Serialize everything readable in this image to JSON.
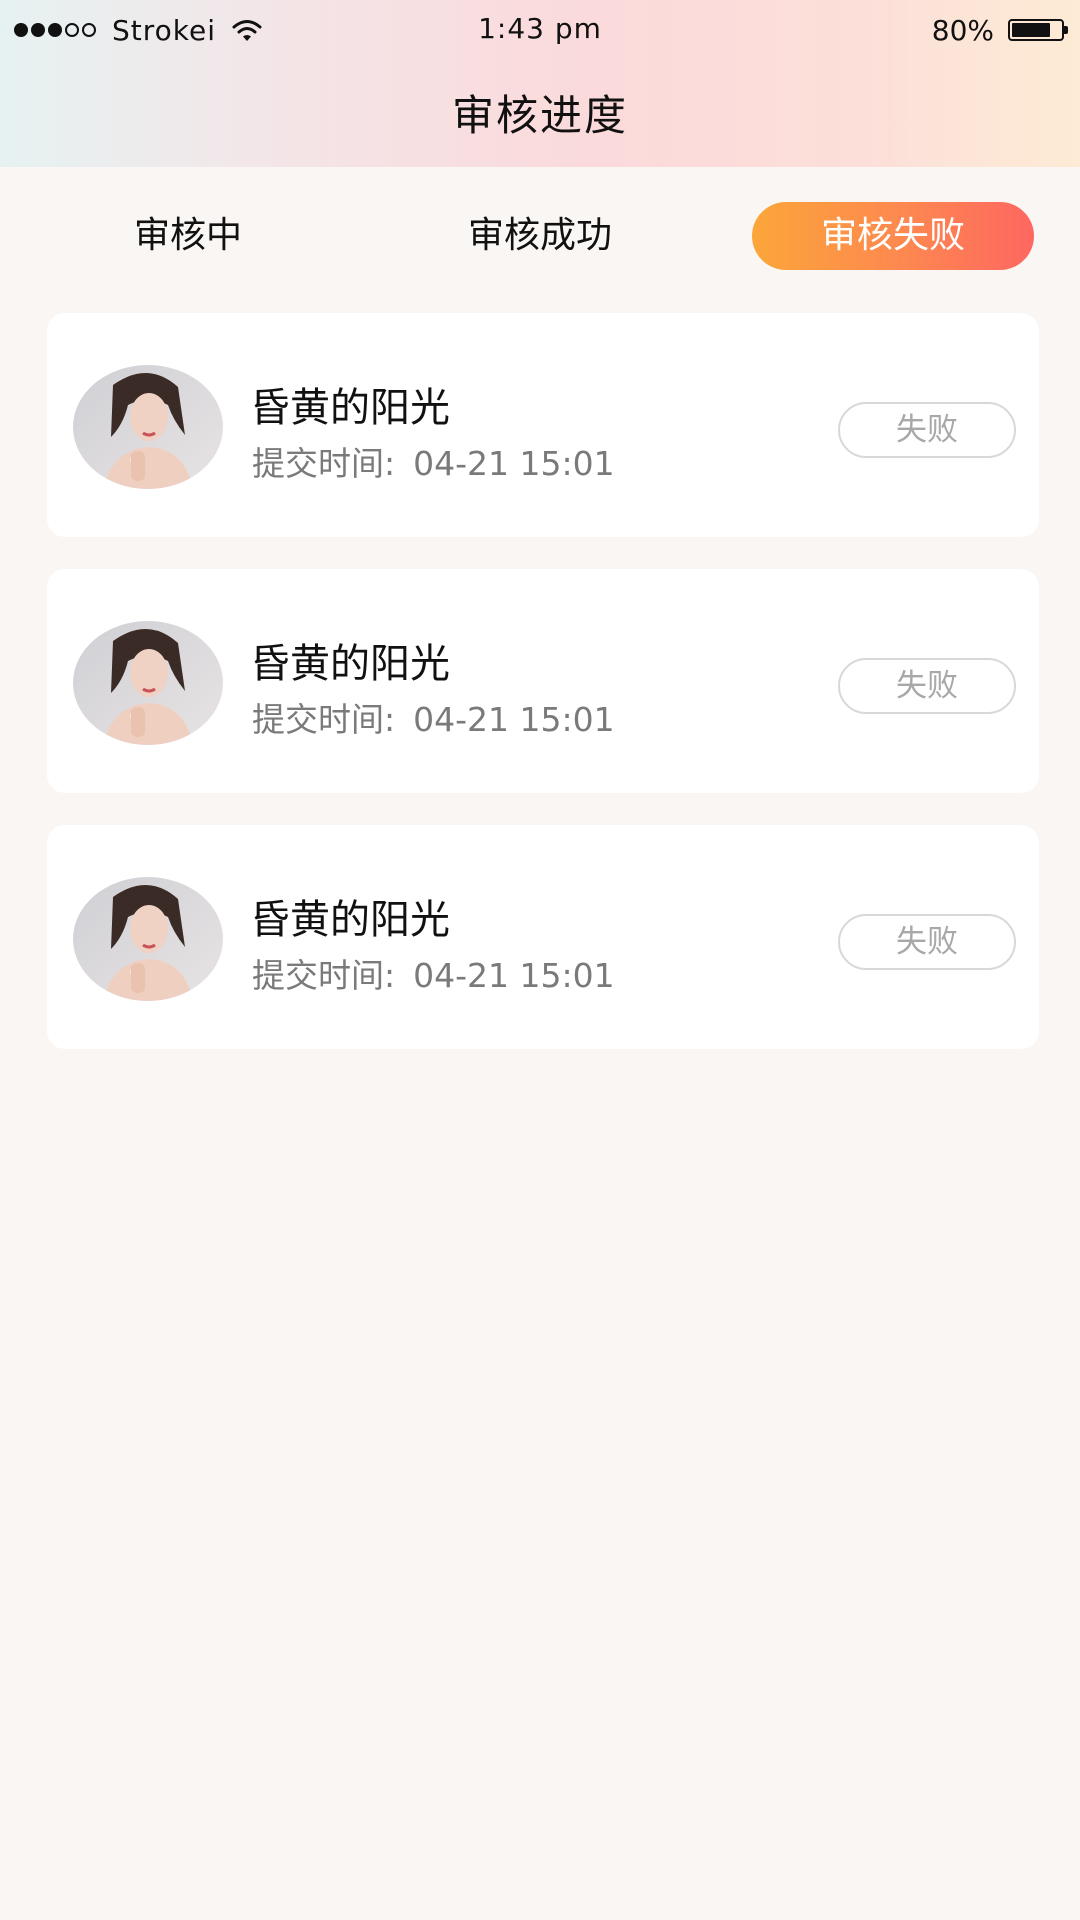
{
  "status_bar": {
    "signal_filled": 3,
    "signal_total": 5,
    "carrier": "Strokei",
    "time": "1:43 pm",
    "battery_percent": "80%",
    "battery_level": 0.8
  },
  "header": {
    "title": "审核进度"
  },
  "tabs": [
    {
      "label": "审核中",
      "active": false
    },
    {
      "label": "审核成功",
      "active": false
    },
    {
      "label": "审核失败",
      "active": true
    }
  ],
  "colors": {
    "active_tab_gradient": [
      "#fca63a",
      "#fe6761"
    ],
    "badge_border": "#d8d8d8",
    "badge_text": "#a8a8a8"
  },
  "records": [
    {
      "avatar": "user-photo",
      "name": "昏黄的阳光",
      "submit_label": "提交时间:",
      "submit_time": "04-21 15:01",
      "status": "失败"
    },
    {
      "avatar": "user-photo",
      "name": "昏黄的阳光",
      "submit_label": "提交时间:",
      "submit_time": "04-21 15:01",
      "status": "失败"
    },
    {
      "avatar": "user-photo",
      "name": "昏黄的阳光",
      "submit_label": "提交时间:",
      "submit_time": "04-21 15:01",
      "status": "失败"
    }
  ]
}
